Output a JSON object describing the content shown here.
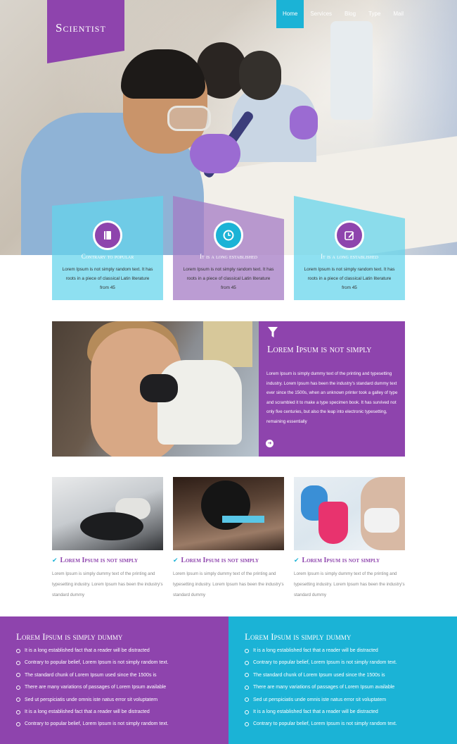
{
  "brand": {
    "logo": "Scientist",
    "purple": "#8e44ad",
    "cyan": "#1bb3d6"
  },
  "nav": {
    "items": [
      "Home",
      "Services",
      "Blog",
      "Type",
      "Mail"
    ],
    "active": "Home"
  },
  "features": [
    {
      "icon": "book-icon",
      "title": "Contrary to popular",
      "text": "Lorem Ipsum is not simply random text. It has roots in a piece of classical Latin literature from 45"
    },
    {
      "icon": "clock-icon",
      "title": "It is a long established",
      "text": "Lorem Ipsum is not simply random text. It has roots in a piece of classical Latin literature from 45"
    },
    {
      "icon": "edit-icon",
      "title": "It is a long established",
      "text": "Lorem Ipsum is not simply random text. It has roots in a piece of classical Latin literature from 45"
    }
  ],
  "middle": {
    "title": "Lorem Ipsum is not simply",
    "text": "Lorem Ipsum is simply dummy text of the printing and typesetting industry. Lorem Ipsum has been the industry's standard dummy text ever since the 1500s, when an unknown printer took a galley of type and scrambled it to make a type specimen book. It has survived not only five centuries, but also the leap into electronic typesetting, remaining essentially"
  },
  "columns": [
    {
      "title": "Lorem Ipsum is not simply",
      "text": "Lorem Ipsum is simply dummy text of the printing and typesetting industry. Lorem Ipsum has been the industry's standard dummy"
    },
    {
      "title": "Lorem Ipsum is not simply",
      "text": "Lorem Ipsum is simply dummy text of the printing and typesetting industry. Lorem Ipsum has been the industry's standard dummy"
    },
    {
      "title": "Lorem Ipsum is not simply",
      "text": "Lorem Ipsum is simply dummy text of the printing and typesetting industry. Lorem Ipsum has been the industry's standard dummy"
    }
  ],
  "footer_left": {
    "title": "Lorem Ipsum is simply dummy",
    "items": [
      "It is a long established fact that a reader will be distracted",
      "Contrary to popular belief, Lorem Ipsum is not simply random text.",
      "The standard chunk of Lorem Ipsum used since the 1500s is",
      "There are many variations of passages of Lorem Ipsum available",
      "Sed ut perspiciatis unde omnis iste natus error sit voluptatem",
      "It is a long established fact that a reader will be distracted",
      "Contrary to popular belief, Lorem Ipsum is not simply random text."
    ]
  },
  "footer_right": {
    "title": "Lorem Ipsum is simply dummy",
    "items": [
      "It is a long established fact that a reader will be distracted",
      "Contrary to popular belief, Lorem Ipsum is not simply random text.",
      "The standard chunk of Lorem Ipsum used since the 1500s is",
      "There are many variations of passages of Lorem Ipsum available",
      "Sed ut perspiciatis unde omnis iste natus error sit voluptatem",
      "It is a long established fact that a reader will be distracted",
      "Contrary to popular belief, Lorem Ipsum is not simply random text."
    ]
  }
}
